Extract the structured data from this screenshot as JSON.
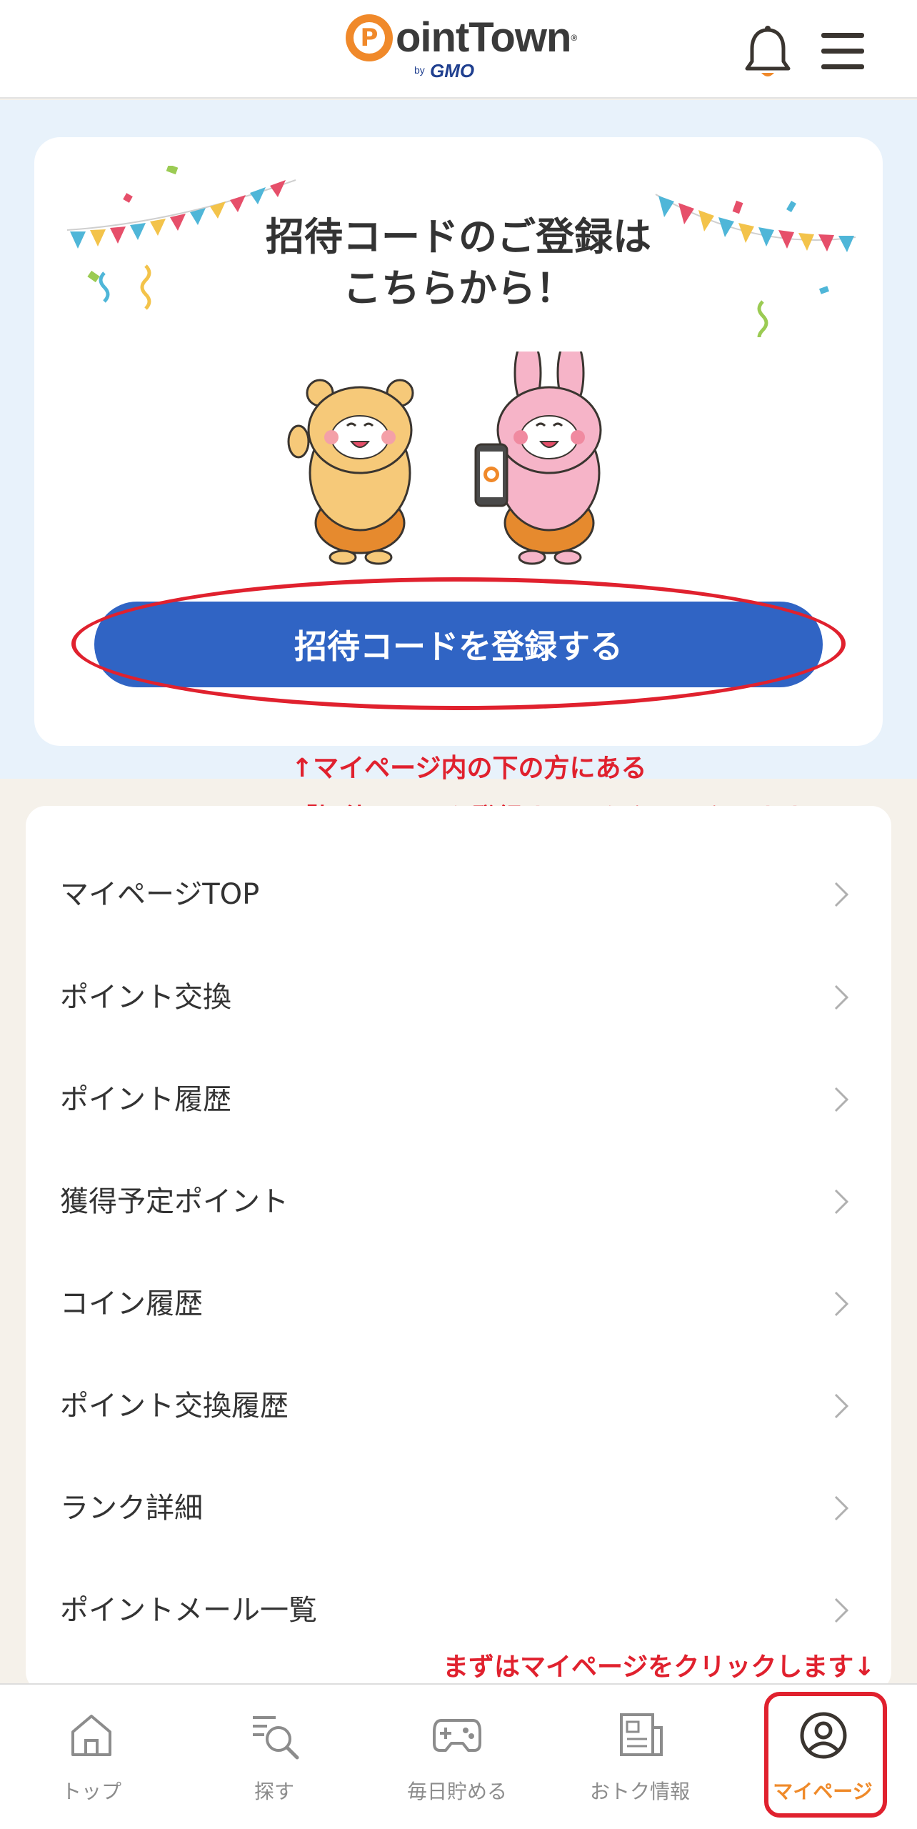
{
  "header": {
    "logo_p": "P",
    "logo_word": "ointTown",
    "logo_reg": "®",
    "logo_by": "by",
    "logo_gmo": "GMO",
    "bell_icon": "bell-icon",
    "menu_icon": "hamburger-menu-icon"
  },
  "invite_card": {
    "title_line1": "招待コードのご登録は",
    "title_line2": "こちらから！",
    "button_label": "招待コードを登録する"
  },
  "annotations": {
    "arrow_up_note": "↑マイページ内の下の方にある",
    "click_note": "「招待コードを登録する」をクリックします",
    "mypage_note": "まずはマイページをクリックします↓"
  },
  "menu": {
    "items": [
      {
        "label": "マイページTOP"
      },
      {
        "label": "ポイント交換"
      },
      {
        "label": "ポイント履歴"
      },
      {
        "label": "獲得予定ポイント"
      },
      {
        "label": "コイン履歴"
      },
      {
        "label": "ポイント交換履歴"
      },
      {
        "label": "ランク詳細"
      },
      {
        "label": "ポイントメール一覧"
      }
    ]
  },
  "bottom_nav": {
    "items": [
      {
        "label": "トップ",
        "icon": "home-icon"
      },
      {
        "label": "探す",
        "icon": "search-list-icon"
      },
      {
        "label": "毎日貯める",
        "icon": "gamepad-icon"
      },
      {
        "label": "おトク情報",
        "icon": "newspaper-icon"
      },
      {
        "label": "マイページ",
        "icon": "user-circle-icon"
      }
    ],
    "active_index": 4
  },
  "colors": {
    "brand_orange": "#f0892a",
    "primary_blue": "#3064c4",
    "annotation_red": "#e0212e",
    "section_blue_bg": "#e8f2fb",
    "page_bg": "#f5f1ea"
  }
}
